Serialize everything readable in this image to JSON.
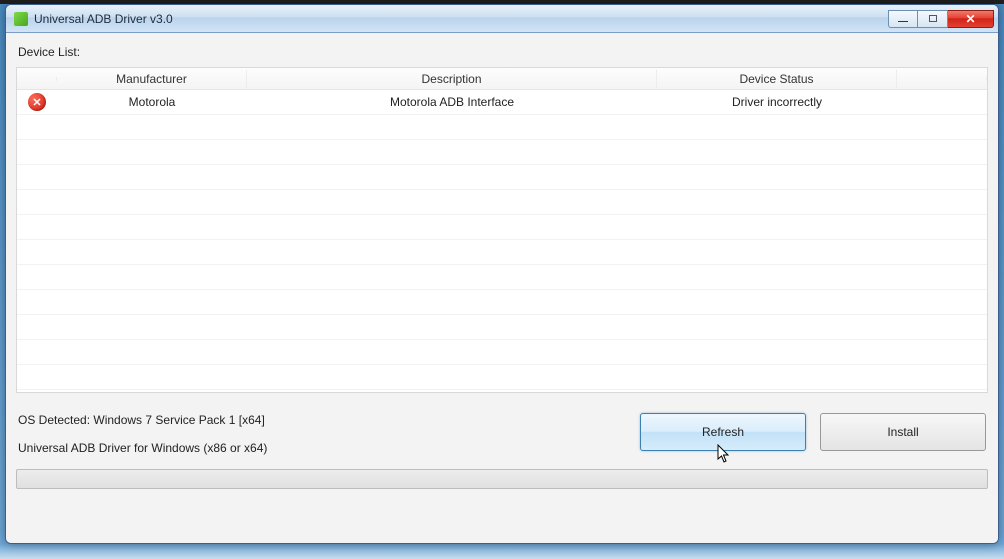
{
  "titlebar": {
    "title": "Universal ADB Driver v3.0"
  },
  "labels": {
    "device_list": "Device List:"
  },
  "grid": {
    "headers": {
      "manufacturer": "Manufacturer",
      "description": "Description",
      "device_status": "Device Status"
    },
    "rows": [
      {
        "status_icon": "error-icon",
        "manufacturer": "Motorola",
        "description": "Motorola ADB Interface",
        "device_status": "Driver incorrectly"
      }
    ]
  },
  "footer": {
    "os_line": "OS Detected: Windows 7 Service Pack 1 [x64]",
    "product_line": "Universal ADB Driver for Windows (x86 or x64)"
  },
  "buttons": {
    "refresh": "Refresh",
    "install": "Install"
  }
}
